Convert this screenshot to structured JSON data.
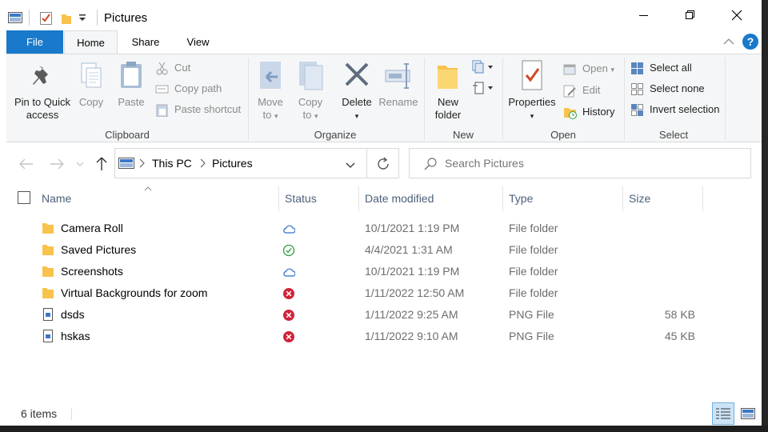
{
  "window": {
    "title": "Pictures"
  },
  "tabs": {
    "file": "File",
    "home": "Home",
    "share": "Share",
    "view": "View"
  },
  "ribbon": {
    "clipboard": {
      "label": "Clipboard",
      "pin": "Pin to Quick access",
      "pin_l1": "Pin to Quick",
      "pin_l2": "access",
      "copy": "Copy",
      "paste": "Paste",
      "cut": "Cut",
      "copy_path": "Copy path",
      "paste_shortcut": "Paste shortcut"
    },
    "organize": {
      "label": "Organize",
      "move_l1": "Move",
      "move_l2": "to",
      "copy_l1": "Copy",
      "copy_l2": "to",
      "delete": "Delete",
      "rename": "Rename"
    },
    "new": {
      "label": "New",
      "folder_l1": "New",
      "folder_l2": "folder"
    },
    "open": {
      "label": "Open",
      "properties": "Properties",
      "open": "Open",
      "edit": "Edit",
      "history": "History"
    },
    "select": {
      "label": "Select",
      "all": "Select all",
      "none": "Select none",
      "invert": "Invert selection"
    }
  },
  "address": {
    "root": "This PC",
    "current": "Pictures"
  },
  "search": {
    "placeholder": "Search Pictures"
  },
  "columns": {
    "name": "Name",
    "status": "Status",
    "date": "Date modified",
    "type": "Type",
    "size": "Size"
  },
  "files": [
    {
      "name": "Camera Roll",
      "status": "cloud",
      "date": "10/1/2021 1:19 PM",
      "type": "File folder",
      "size": ""
    },
    {
      "name": "Saved Pictures",
      "status": "synced",
      "date": "4/4/2021 1:31 AM",
      "type": "File folder",
      "size": ""
    },
    {
      "name": "Screenshots",
      "status": "cloud",
      "date": "10/1/2021 1:19 PM",
      "type": "File folder",
      "size": ""
    },
    {
      "name": "Virtual Backgrounds for zoom",
      "status": "error",
      "date": "1/11/2022 12:50 AM",
      "type": "File folder",
      "size": ""
    },
    {
      "name": "dsds",
      "status": "error",
      "date": "1/11/2022 9:25 AM",
      "type": "PNG File",
      "size": "58 KB"
    },
    {
      "name": "hskas",
      "status": "error",
      "date": "1/11/2022 9:10 AM",
      "type": "PNG File",
      "size": "45 KB"
    }
  ],
  "statusbar": {
    "count": "6 items"
  },
  "colors": {
    "accent": "#1979ca",
    "folder": "#f8c24d",
    "cloud": "#2b6fc9",
    "synced": "#2d9c3c",
    "error": "#d0243a"
  }
}
